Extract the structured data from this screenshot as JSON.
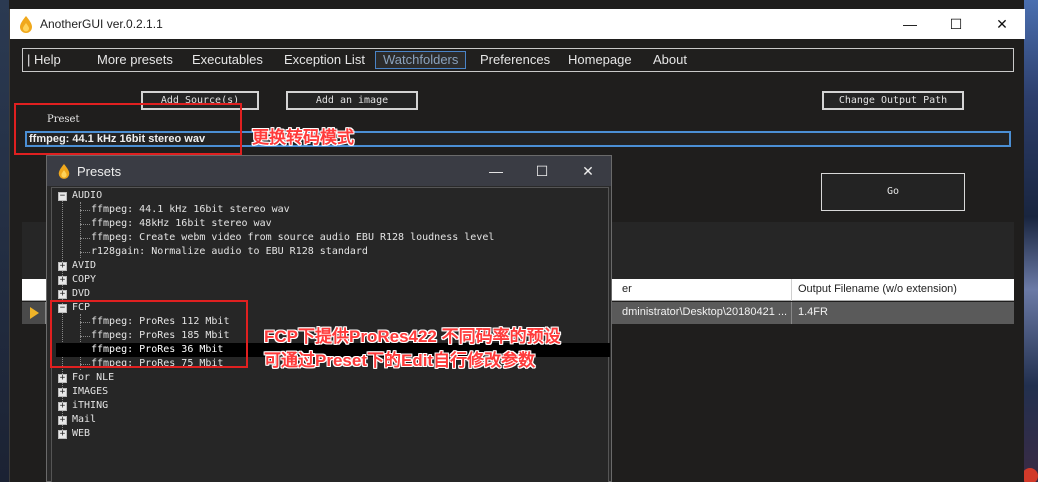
{
  "app": {
    "title": "AnotherGUI ver.0.2.1.1",
    "controls": {
      "minimize": "—",
      "maximize": "☐",
      "close": "✕"
    }
  },
  "menu": {
    "items": [
      "| Help",
      "More presets",
      "Executables",
      "Exception List",
      "Watchfolders",
      "Preferences",
      "Homepage",
      "About"
    ],
    "active": "Watchfolders"
  },
  "toolbar": {
    "add_source": "Add Source(s)",
    "add_image": "Add an image",
    "change_output": "Change Output Path"
  },
  "preset": {
    "label": "Preset",
    "value": "ffmpeg: 44.1 kHz 16bit stereo wav"
  },
  "go_label": "Go",
  "table": {
    "headers": [
      "er",
      "Output Filename (w/o extension)"
    ],
    "row": {
      "source": "dministrator\\Desktop\\20180421 ...",
      "output": "1.4FR"
    }
  },
  "annotations": {
    "preset_note": "更换转码模式",
    "fcp_note_line1": "FCP下提供ProRes422 不同码率的预设",
    "fcp_note_line2": "可通过Preset下的Edit自行修改参数",
    "color": "#ff3b3b"
  },
  "presets_window": {
    "title": "Presets",
    "tree": [
      {
        "label": "AUDIO",
        "expanded": true,
        "children": [
          "ffmpeg: 44.1 kHz 16bit stereo wav",
          "ffmpeg: 48kHz 16bit stereo wav",
          "ffmpeg: Create webm video from source audio EBU R128 loudness level",
          "r128gain: Normalize audio to EBU R128 standard"
        ]
      },
      {
        "label": "AVID",
        "expanded": false
      },
      {
        "label": "COPY",
        "expanded": false
      },
      {
        "label": "DVD",
        "expanded": false
      },
      {
        "label": "FCP",
        "expanded": true,
        "children": [
          "ffmpeg: ProRes 112 Mbit",
          "ffmpeg: ProRes 185 Mbit",
          "ffmpeg: ProRes 36 Mbit",
          "ffmpeg: ProRes 75 Mbit"
        ]
      },
      {
        "label": "For NLE",
        "expanded": false
      },
      {
        "label": "IMAGES",
        "expanded": false
      },
      {
        "label": "iTHING",
        "expanded": false
      },
      {
        "label": "Mail",
        "expanded": false
      },
      {
        "label": "WEB",
        "expanded": false
      }
    ],
    "selected": "ffmpeg: ProRes 36 Mbit"
  },
  "colors": {
    "accent_blue": "#4b8fd4",
    "annotation_red": "#e02020",
    "row_marker": "#f0b428"
  }
}
